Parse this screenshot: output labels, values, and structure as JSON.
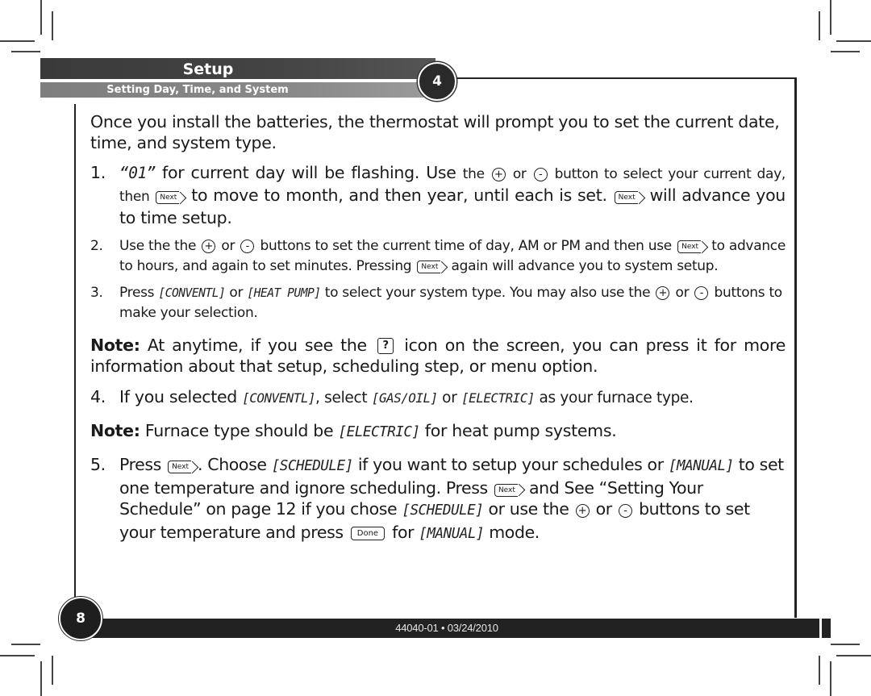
{
  "header": {
    "section_title": "Setup",
    "subsection_title": "Setting Day, Time, and System",
    "chapter_number": "4"
  },
  "icons": {
    "plus": "+",
    "minus": "-",
    "next": "Next",
    "done": "Done",
    "help": "?"
  },
  "content": {
    "intro": "Once you install the batteries, the thermostat will prompt you to set the current date, time, and system type.",
    "items": [
      {
        "number": "1.",
        "parts": {
          "lcd_day": "“01”",
          "t1": " for current day will be flashing. Use ",
          "t2": "the ",
          "t3": " or ",
          "t4": " button to select your current day, then ",
          "t5": " to move to month, and then year, until each is set. ",
          "t6": " will advance you to time setup."
        }
      },
      {
        "number": "2.",
        "parts": {
          "t1": "Use the the ",
          "t2": " or ",
          "t3": " buttons to set the current time of day, AM or PM and then use ",
          "t4": " to advance to hours, and again to set minutes. Pressing ",
          "t5": " again will advance you to system setup."
        }
      },
      {
        "number": "3.",
        "parts": {
          "t1": "Press ",
          "lcd1": "[CONVENTL]",
          "t2": " or ",
          "lcd2": "[HEAT PUMP]",
          "t3": " to select your system type. You may also use the ",
          "t4": " or ",
          "t5": " buttons to make your selection."
        }
      },
      {
        "number": "4.",
        "parts": {
          "t1": "If you selected ",
          "lcd1": "[CONVENTL]",
          "t2": ", select ",
          "lcd2": "[GAS/OIL]",
          "t3": " or ",
          "lcd3": "[ELECTRIC]",
          "t4": " as your furnace type."
        }
      },
      {
        "number": "5.",
        "parts": {
          "t1": "Press ",
          "t2": ". Choose ",
          "lcd1": "[SCHEDULE]",
          "t3": " if you want to setup your schedules or ",
          "lcd2": "[MANUAL]",
          "t4": " to set one temperature and ignore scheduling. Press ",
          "t5": " and See “Setting Your Schedule” on page 12 if you chose ",
          "lcd3": "[SCHEDULE]",
          "t6": " or use the ",
          "t7": " or ",
          "t8": " buttons to set your temperature and press ",
          "t9": " for ",
          "lcd4": "[MANUAL]",
          "t10": " mode."
        }
      }
    ],
    "notes": [
      {
        "label": "Note:",
        "t1": " At anytime, if you see the ",
        "t2": " icon on the screen, you can press it for more information about that setup, scheduling step, or menu option."
      },
      {
        "label": "Note:",
        "t1": " Furnace type should be ",
        "lcd1": "[ELECTRIC]",
        "t2": " for heat pump systems."
      }
    ]
  },
  "footer": {
    "doc_info": "44040-01 • 03/24/2010",
    "page_number": "8"
  }
}
